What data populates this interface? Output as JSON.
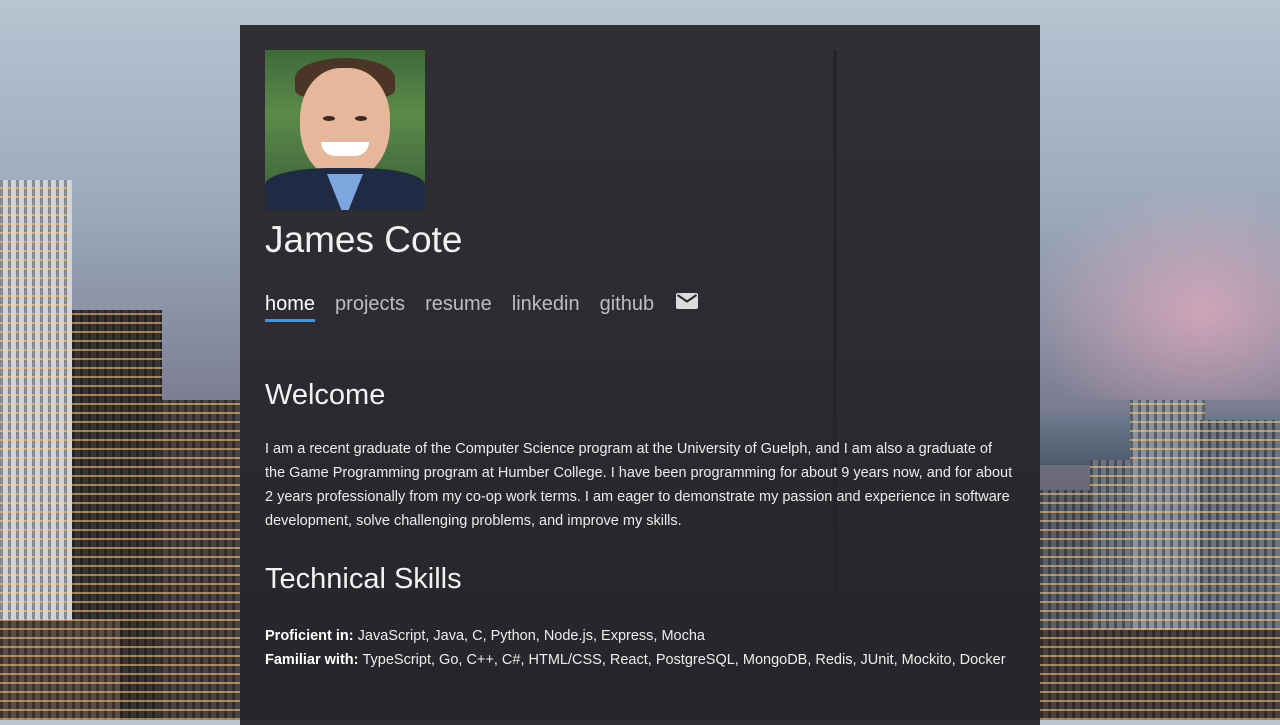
{
  "profile": {
    "name": "James Cote",
    "photo_alt": "portrait photo"
  },
  "nav": {
    "items": [
      {
        "label": "home",
        "active": true
      },
      {
        "label": "projects",
        "active": false
      },
      {
        "label": "resume",
        "active": false
      },
      {
        "label": "linkedin",
        "active": false
      },
      {
        "label": "github",
        "active": false
      }
    ],
    "mail_icon": "mail-icon"
  },
  "welcome": {
    "title": "Welcome",
    "body": "I am a recent graduate of the Computer Science program at the University of Guelph, and I am also a graduate of the Game Programming program at Humber College. I have been programming for about 9 years now, and for about 2 years professionally from my co-op work terms. I am eager to demonstrate my passion and experience in software development, solve challenging problems, and improve my skills."
  },
  "skills": {
    "title": "Technical Skills",
    "proficient_label": "Proficient in:",
    "proficient_value": "JavaScript, Java, C, Python, Node.js, Express, Mocha",
    "familiar_label": "Familiar with:",
    "familiar_value": "TypeScript, Go, C++, C#, HTML/CSS, React, PostgreSQL, MongoDB, Redis, JUnit, Mockito, Docker"
  },
  "colors": {
    "accent": "#2d9cf0",
    "card_bg": "#262428"
  }
}
